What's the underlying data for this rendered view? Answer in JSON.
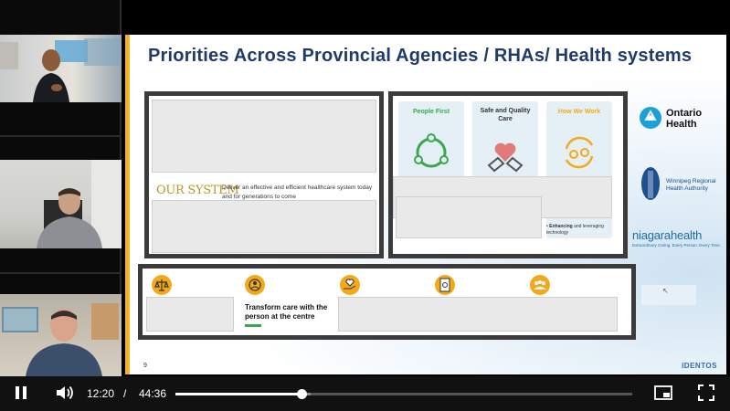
{
  "slide": {
    "title": "Priorities Across Provincial Agencies / RHAs/ Health systems",
    "our_system_label": "OUR SYSTEM",
    "our_system_desc": "Deliver an effective and efficient healthcare system today and for generations to come",
    "cards": [
      {
        "title": "People First",
        "color": "#3aa651",
        "icon": "people-circle-icon"
      },
      {
        "title": "Safe and Quality Care",
        "color": "#333333",
        "icon": "heart-hands-icon"
      },
      {
        "title": "How We Work",
        "color": "#f2a91c",
        "icon": "cycle-people-icon"
      }
    ],
    "enhancing_bold": "Enhancing",
    "enhancing_rest": " and leveraging technology",
    "transform_text": "Transform care with the person at the centre",
    "logos": {
      "ontario": "Ontario Health",
      "ontario_line1": "Ontario",
      "ontario_line2": "Health",
      "wrha_line1": "Winnipeg Regional",
      "wrha_line2": "Health Authority",
      "niagara": "niagarahealth",
      "niagara_tag": "Extraordinary Caring. Every Person. Every Time."
    },
    "slide_number": "9",
    "brand": "IDENTOS",
    "accent_color": "#f0b323",
    "title_color": "#1f3a6b"
  },
  "player": {
    "current_time": "12:20",
    "separator": "/",
    "total_time": "44:36",
    "progress_fraction": 0.2765,
    "buffered_fraction": 0.295
  }
}
